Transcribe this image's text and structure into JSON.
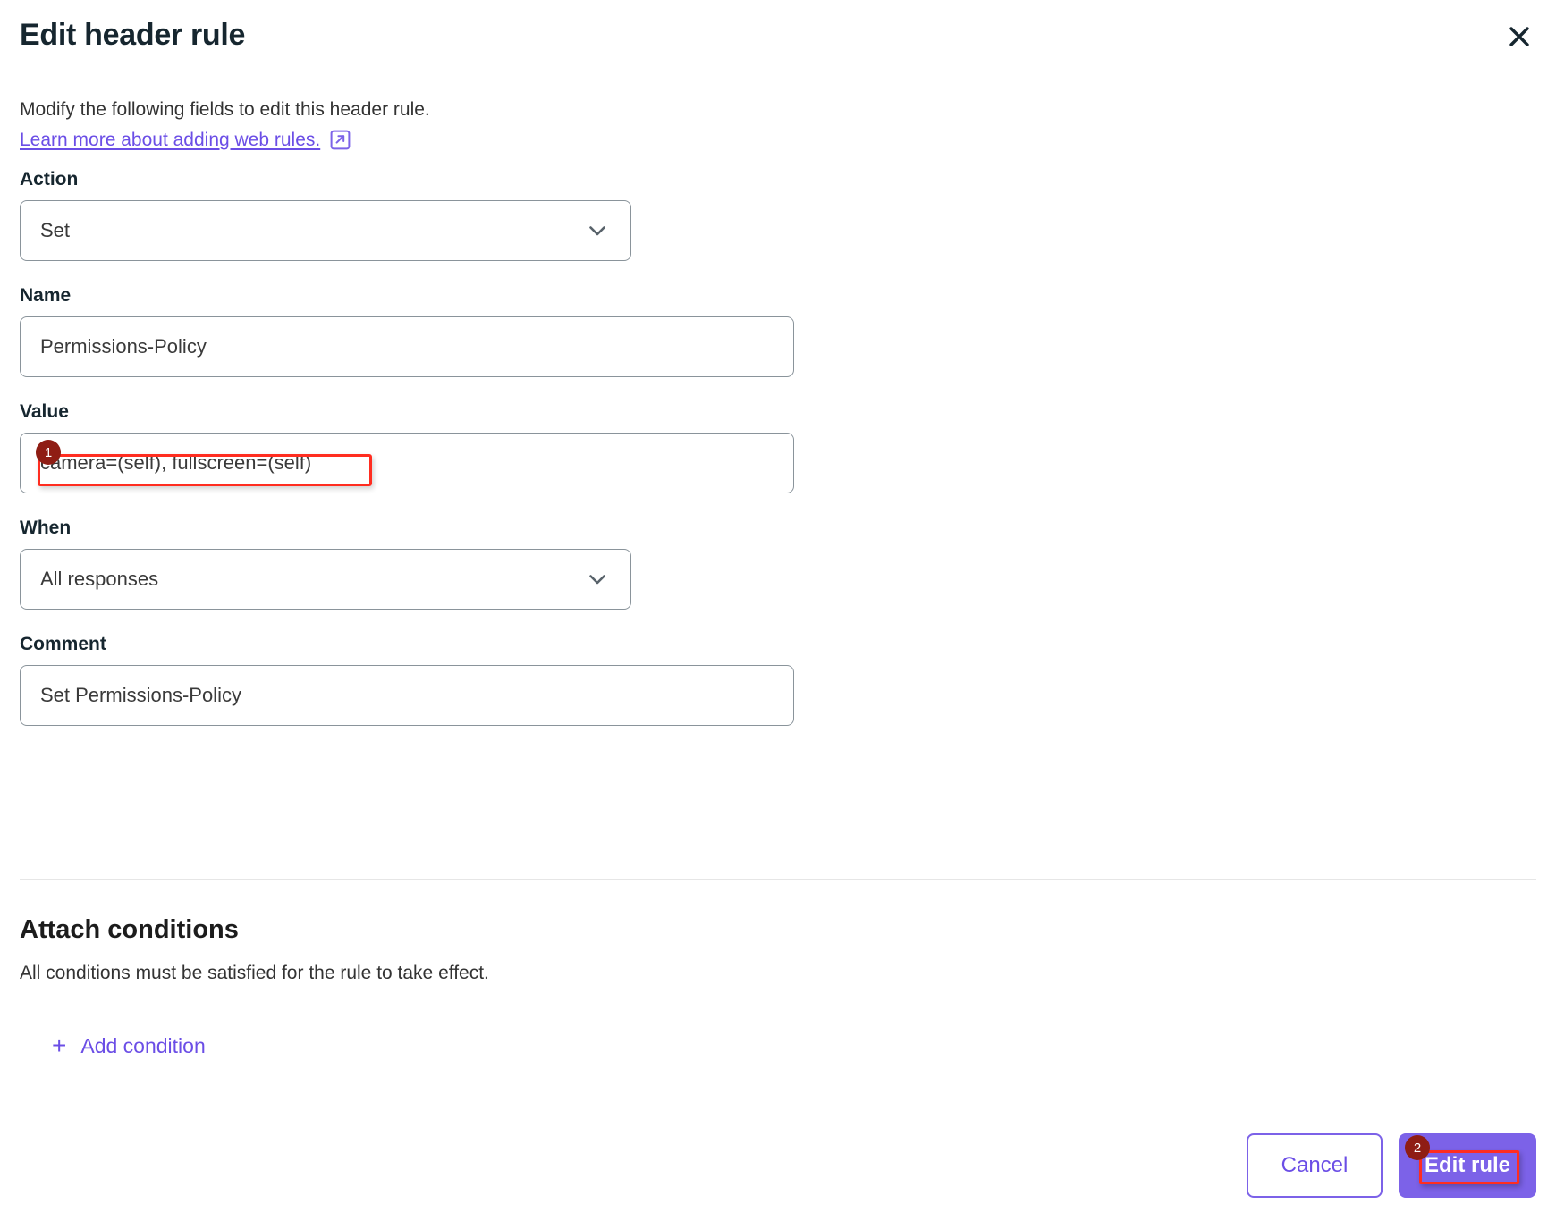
{
  "dialog": {
    "title": "Edit header rule",
    "close_icon": "close-icon",
    "intro_text": "Modify the following fields to edit this header rule.",
    "learn_more_label": "Learn more about adding web rules.",
    "external_link_icon": "external-link-icon"
  },
  "form": {
    "action": {
      "label": "Action",
      "value": "Set"
    },
    "name": {
      "label": "Name",
      "value": "Permissions-Policy"
    },
    "value": {
      "label": "Value",
      "value": "camera=(self), fullscreen=(self)"
    },
    "when": {
      "label": "When",
      "value": "All responses"
    },
    "comment": {
      "label": "Comment",
      "value": "Set Permissions-Policy"
    }
  },
  "conditions": {
    "title": "Attach conditions",
    "subtitle": "All conditions must be satisfied for the rule to take effect.",
    "add_condition_label": "Add condition",
    "plus_icon": "plus-icon"
  },
  "footer": {
    "cancel_label": "Cancel",
    "submit_label": "Edit rule"
  },
  "annotations": {
    "marker_1": "1",
    "marker_2": "2"
  },
  "colors": {
    "accent_purple": "#7c62e8",
    "link_purple": "#6b4ee6",
    "heading_navy": "#16262f",
    "annotation_red": "#ff2d20",
    "badge_maroon": "#8f1d14",
    "border_grey": "#8a949b"
  }
}
